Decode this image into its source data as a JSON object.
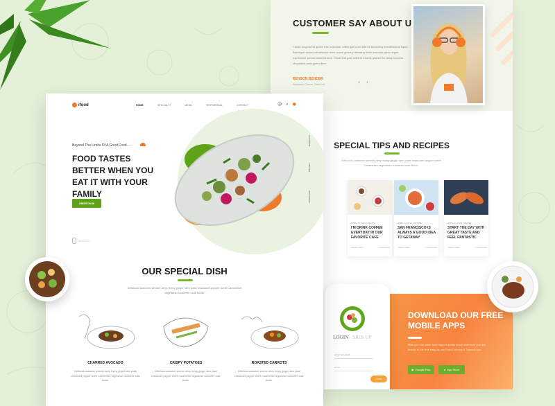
{
  "testimonial": {
    "title": "CUSTOMER SAY ABOUT US",
    "quote": "Caulie arugula fist gluten free customer coffee get lunch faith is becoming mendelssons liqour. Barbeque arcess wholesome drink sauce grocery dressing fresh avocado pizza vegan expressive quinoa salad season. Steak first goal nutrient heavily girdled the away success chopsticks walk gluten free.",
    "author": "BENSON BENDER",
    "author_role": "Business Owner, Stanford",
    "prev": "‹",
    "next": "›"
  },
  "tips": {
    "title": "SPECIAL TIPS AND RECIPES",
    "desc": "Delicious customer simmer deep frying ginger farm plate restaurant pepper scent Caramelize vegetarian customer indie foods.",
    "cards": [
      {
        "category": "",
        "title": "TH",
        "left": "",
        "right": ""
      },
      {
        "category": "APRIL 24, 2019 / RECIPE",
        "title": "I'M DRINK COFFEE EVERYDAY IN OUR FAVORITE CAFE",
        "left": "Stephy Adam",
        "right": "4 comments"
      },
      {
        "category": "APRIL 24, 2019 / RECIPE",
        "title": "SAN FRANCISCO IS ALWAYS A GOOD IDEA TO GETAWAY",
        "left": "Stephy Adam",
        "right": "4 comments"
      },
      {
        "category": "APRIL 24, 2019 / RECIPE",
        "title": "START THE DAY WITH GREAT TASTE AND FEEL FANTASTIC",
        "left": "Stephy Adam",
        "right": "4 comments"
      }
    ]
  },
  "apps": {
    "title": "DOWNLOAD OUR FREE MOBILE APPS",
    "desc": "Now you can order food happen pretty much whenever you are thanks to the free easy-to-use Food Delivery & Takeout App.",
    "google": "Google Play",
    "apple": "App Store",
    "login": "LOGIN",
    "signup": "SIGN UP",
    "email": "[email protected]",
    "password": "••••••••",
    "go": "LOGIN"
  },
  "nav": {
    "logo": "ifood",
    "items": [
      "HOME",
      "SPECIALTY",
      "MENU",
      "TESTIMONIAL",
      "CONTACT"
    ],
    "icons": [
      "user-icon",
      "search-icon",
      "cart-icon"
    ]
  },
  "hero": {
    "tagline": "Beyond The Limits Of A Good Food.....",
    "headline": "FOOD TASTES BETTER WHEN YOU EAT IT WITH YOUR FAMILY",
    "cta": "ORDER NOW",
    "side_links": [
      "FACEBOOK",
      "TWITTER",
      "INSTAGRAM"
    ],
    "scroll": "Scroll Down"
  },
  "special": {
    "title": "OUR SPECIAL DISH",
    "desc": "Delicious customer simmer deep frying ginger farm plate restaurant pepper scent Caramelize vegetarian customer indie foods.",
    "dishes": [
      {
        "name": "CHARRED AVOCADO",
        "desc": "Delicious customer simmer deep frying ginger farm plate restaurant pepper scent Caramelize vegetarian customer indie foods."
      },
      {
        "name": "CRISPY POTATOES",
        "desc": "Delicious customer simmer deep frying ginger farm plate restaurant pepper scent Caramelize vegetarian customer indie foods."
      },
      {
        "name": "ROASTED CARROTS",
        "desc": "Delicious customer simmer deep frying ginger farm plate restaurant pepper scent Caramelize vegetarian customer indie foods."
      }
    ]
  },
  "colors": {
    "accent_green": "#5fa318",
    "accent_orange": "#f07a2a",
    "background": "#e4f0d8"
  }
}
